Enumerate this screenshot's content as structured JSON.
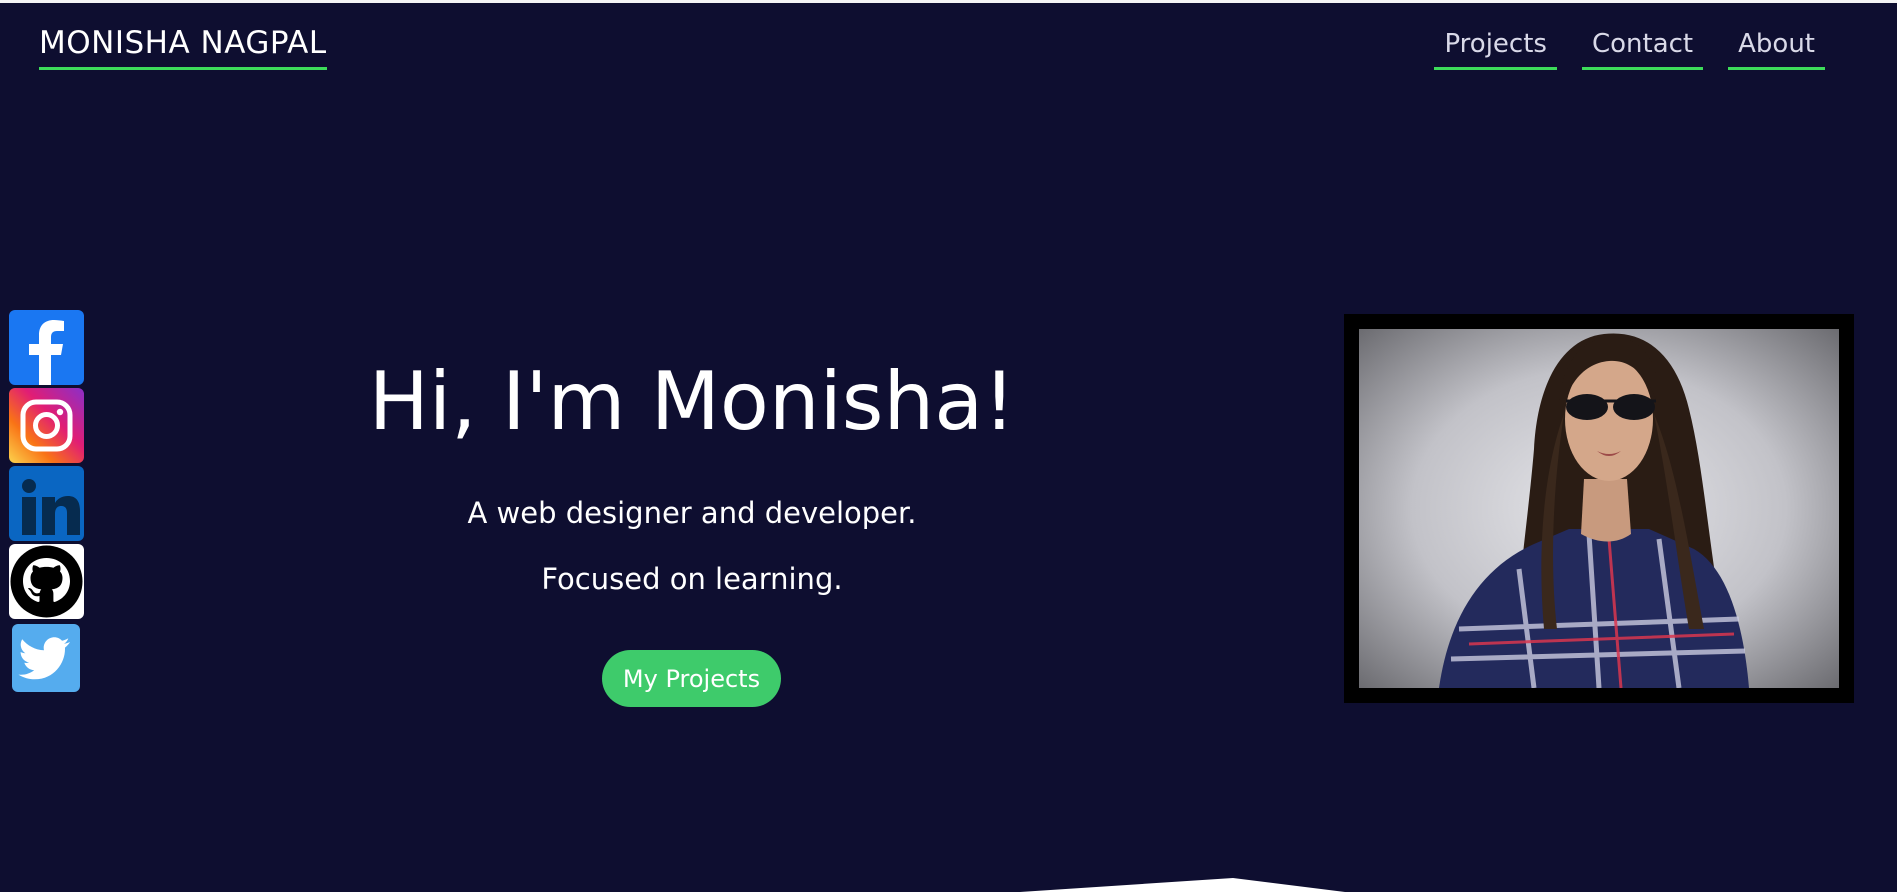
{
  "header": {
    "brand": "MONISHA NAGPAL",
    "nav": [
      {
        "label": "Projects"
      },
      {
        "label": "Contact"
      },
      {
        "label": "About"
      }
    ]
  },
  "social": [
    {
      "name": "facebook",
      "icon": "facebook-icon"
    },
    {
      "name": "instagram",
      "icon": "instagram-icon"
    },
    {
      "name": "linkedin",
      "icon": "linkedin-icon"
    },
    {
      "name": "github",
      "icon": "github-icon"
    },
    {
      "name": "twitter",
      "icon": "twitter-icon"
    }
  ],
  "hero": {
    "title": "Hi, I'm Monisha!",
    "line1": "A web designer and developer.",
    "line2": "Focused on learning.",
    "cta": "My Projects"
  },
  "colors": {
    "background": "#0e0e30",
    "accent": "#3ddc5a",
    "button": "#3ecb6b"
  }
}
